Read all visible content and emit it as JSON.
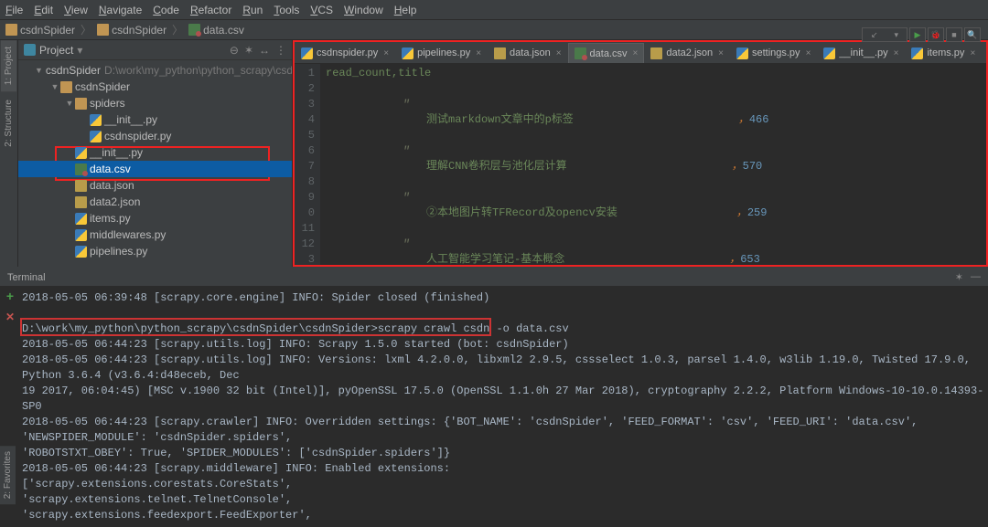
{
  "menu": {
    "items": [
      "File",
      "Edit",
      "View",
      "Navigate",
      "Code",
      "Refactor",
      "Run",
      "Tools",
      "VCS",
      "Window",
      "Help"
    ]
  },
  "breadcrumb": {
    "root": "csdnSpider",
    "mid": "csdnSpider",
    "file": "data.csv"
  },
  "run_box": {
    "placeholder": "..."
  },
  "project": {
    "title": "Project",
    "rootName": "csdnSpider",
    "rootPath": "D:\\work\\my_python\\python_scrapy\\csdnS",
    "pkg": "csdnSpider",
    "spidersFolder": "spiders",
    "files_spiders": [
      "__init__.py",
      "csdnspider.py"
    ],
    "files_pkg": [
      "__init__.py",
      "data.csv",
      "data.json",
      "data2.json",
      "items.py",
      "middlewares.py",
      "pipelines.py"
    ]
  },
  "editor_tabs": [
    {
      "label": "csdnspider.py",
      "icon": "py"
    },
    {
      "label": "pipelines.py",
      "icon": "py"
    },
    {
      "label": "data.json",
      "icon": "json"
    },
    {
      "label": "data.csv",
      "icon": "csv",
      "active": true
    },
    {
      "label": "data2.json",
      "icon": "json"
    },
    {
      "label": "settings.py",
      "icon": "py"
    },
    {
      "label": "__init__.py",
      "icon": "py"
    },
    {
      "label": "items.py",
      "icon": "py"
    }
  ],
  "csv": {
    "header": "read_count,title",
    "rows": [
      {
        "title": "测试markdown文章中的p标签",
        "count": "466"
      },
      {
        "title": "理解CNN卷积层与池化层计算",
        "count": "570"
      },
      {
        "title": "②本地图片转TFRecord及opencv安装",
        "count": "259"
      },
      {
        "title": "人工智能学习笔记-基本概念",
        "count": "653"
      }
    ],
    "quote": "\"",
    "comma_mark": "，"
  },
  "gutter_start": 1,
  "terminal": {
    "title": "Terminal",
    "lines": [
      "2018-05-05 06:39:48 [scrapy.core.engine] INFO: Spider closed (finished)",
      "",
      "D:\\work\\my_python\\python_scrapy\\csdnSpider\\csdnSpider>scrapy crawl csdn -o data.csv",
      "2018-05-05 06:44:23 [scrapy.utils.log] INFO: Scrapy 1.5.0 started (bot: csdnSpider)",
      "2018-05-05 06:44:23 [scrapy.utils.log] INFO: Versions: lxml 4.2.0.0, libxml2 2.9.5, cssselect 1.0.3, parsel 1.4.0, w3lib 1.19.0, Twisted 17.9.0, Python 3.6.4 (v3.6.4:d48eceb, Dec",
      " 19 2017, 06:04:45) [MSC v.1900 32 bit (Intel)], pyOpenSSL 17.5.0 (OpenSSL 1.1.0h  27 Mar 2018), cryptography 2.2.2, Platform Windows-10-10.0.14393-SP0",
      "2018-05-05 06:44:23 [scrapy.crawler] INFO: Overridden settings: {'BOT_NAME': 'csdnSpider', 'FEED_FORMAT': 'csv', 'FEED_URI': 'data.csv', 'NEWSPIDER_MODULE': 'csdnSpider.spiders',",
      " 'ROBOTSTXT_OBEY': True, 'SPIDER_MODULES': ['csdnSpider.spiders']}",
      "2018-05-05 06:44:23 [scrapy.middleware] INFO: Enabled extensions:",
      "['scrapy.extensions.corestats.CoreStats',",
      " 'scrapy.extensions.telnet.TelnetConsole',",
      " 'scrapy.extensions.feedexport.FeedExporter',"
    ]
  },
  "side_tabs": {
    "project": "1: Project",
    "structure": "2: Structure",
    "favorites": "2: Favorites"
  }
}
